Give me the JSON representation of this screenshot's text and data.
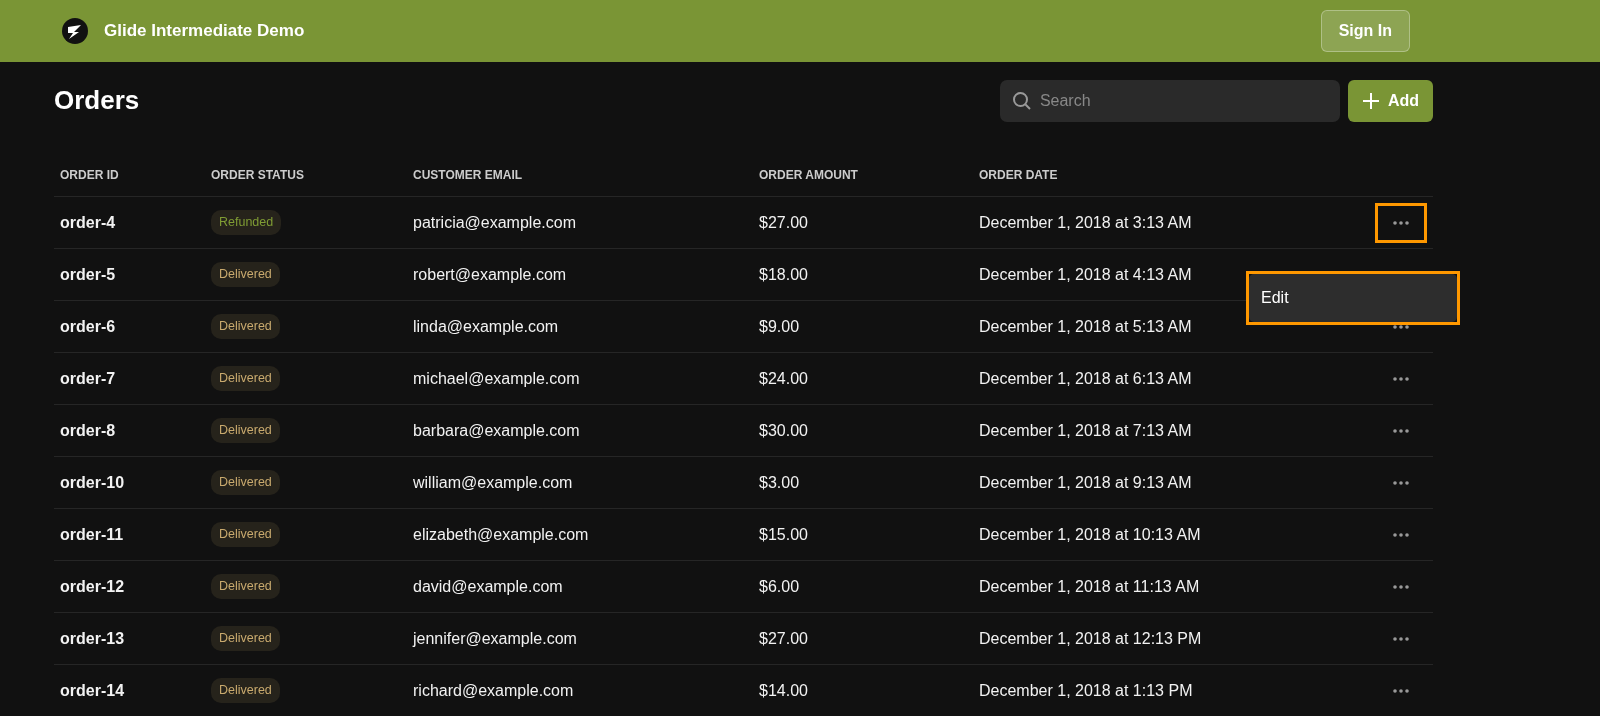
{
  "app": {
    "title": "Glide Intermediate Demo",
    "sign_in": "Sign In"
  },
  "page": {
    "title": "Orders",
    "search": {
      "placeholder": "Search"
    },
    "add_button": "Add"
  },
  "table": {
    "columns": [
      "ORDER ID",
      "ORDER STATUS",
      "CUSTOMER EMAIL",
      "ORDER AMOUNT",
      "ORDER DATE"
    ],
    "rows": [
      {
        "id": "order-4",
        "status": "Refunded",
        "color": "#7f9c34",
        "email": "patricia@example.com",
        "amount": "$27.00",
        "date": "December 1, 2018 at 3:13 AM",
        "actions": true,
        "highlighted": true
      },
      {
        "id": "order-5",
        "status": "Delivered",
        "color": "#c9aa6e",
        "email": "robert@example.com",
        "amount": "$18.00",
        "date": "December 1, 2018 at 4:13 AM",
        "actions": false
      },
      {
        "id": "order-6",
        "status": "Delivered",
        "color": "#c9aa6e",
        "email": "linda@example.com",
        "amount": "$9.00",
        "date": "December 1, 2018 at 5:13 AM",
        "actions": true,
        "highlighted": false
      },
      {
        "id": "order-7",
        "status": "Delivered",
        "color": "#c9aa6e",
        "email": "michael@example.com",
        "amount": "$24.00",
        "date": "December 1, 2018 at 6:13 AM",
        "actions": true,
        "highlighted": false
      },
      {
        "id": "order-8",
        "status": "Delivered",
        "color": "#c9aa6e",
        "email": "barbara@example.com",
        "amount": "$30.00",
        "date": "December 1, 2018 at 7:13 AM",
        "actions": true,
        "highlighted": false
      },
      {
        "id": "order-10",
        "status": "Delivered",
        "color": "#c9aa6e",
        "email": "william@example.com",
        "amount": "$3.00",
        "date": "December 1, 2018 at 9:13 AM",
        "actions": true,
        "highlighted": false
      },
      {
        "id": "order-11",
        "status": "Delivered",
        "color": "#c9aa6e",
        "email": "elizabeth@example.com",
        "amount": "$15.00",
        "date": "December 1, 2018 at 10:13 AM",
        "actions": true,
        "highlighted": false
      },
      {
        "id": "order-12",
        "status": "Delivered",
        "color": "#c9aa6e",
        "email": "david@example.com",
        "amount": "$6.00",
        "date": "December 1, 2018 at 11:13 AM",
        "actions": true,
        "highlighted": false
      },
      {
        "id": "order-13",
        "status": "Delivered",
        "color": "#c9aa6e",
        "email": "jennifer@example.com",
        "amount": "$27.00",
        "date": "December 1, 2018 at 12:13 PM",
        "actions": true,
        "highlighted": false
      },
      {
        "id": "order-14",
        "status": "Delivered",
        "color": "#c9aa6e",
        "email": "richard@example.com",
        "amount": "$14.00",
        "date": "December 1, 2018 at 1:13 PM",
        "actions": true,
        "highlighted": false
      }
    ]
  },
  "context_menu": {
    "highlighted": true,
    "items": [
      {
        "label": "Edit"
      }
    ]
  }
}
